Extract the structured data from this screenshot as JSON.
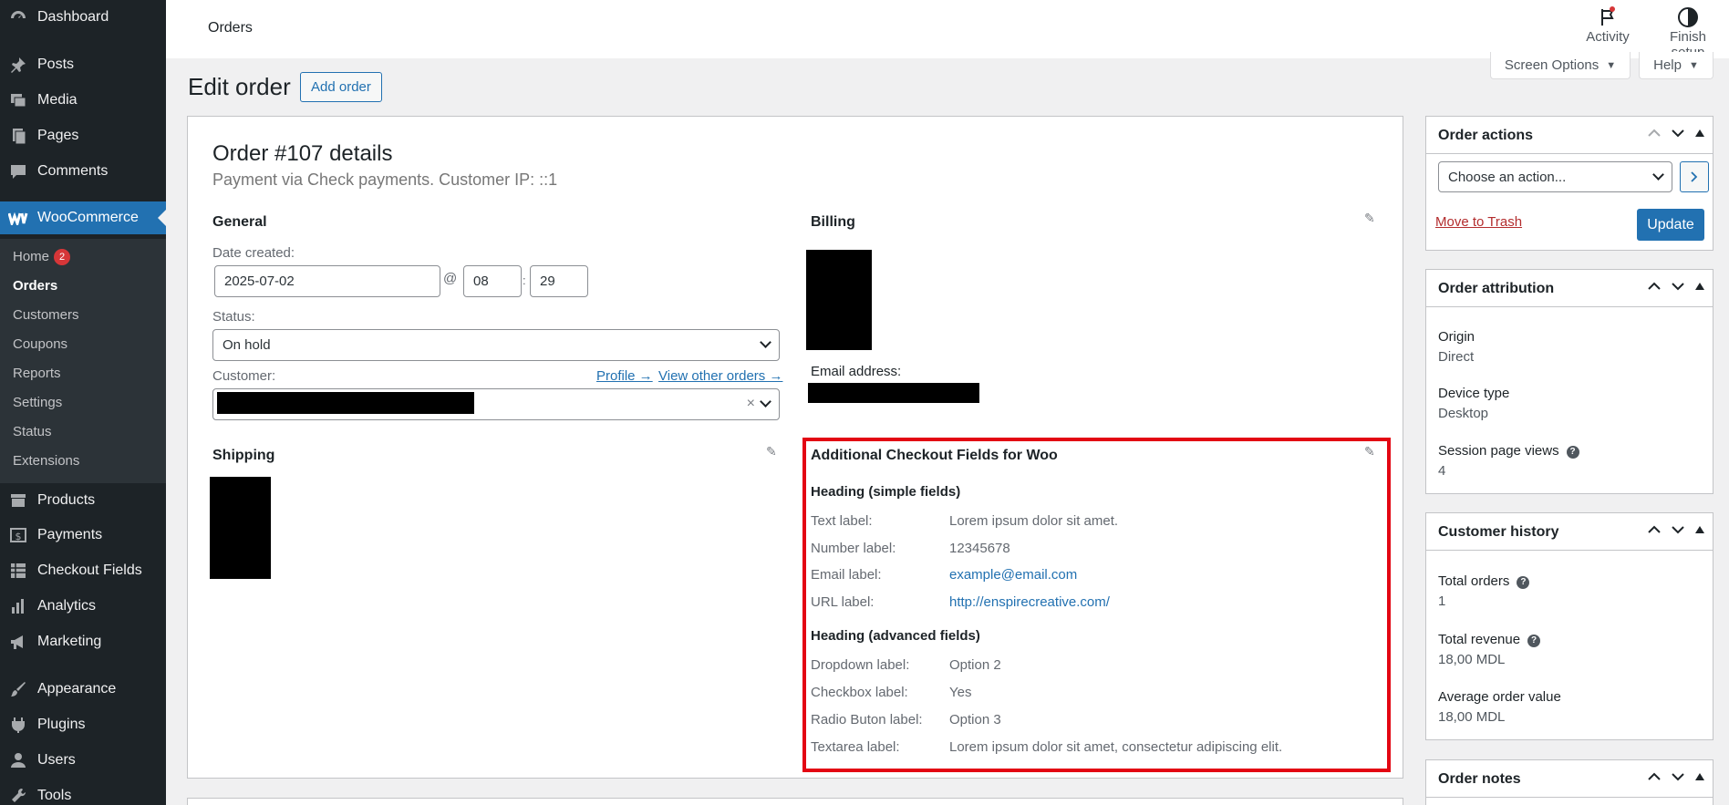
{
  "sidebar": {
    "items": [
      {
        "label": "Dashboard",
        "icon": "dashboard-icon"
      },
      {
        "label": "Posts",
        "icon": "pin-icon"
      },
      {
        "label": "Media",
        "icon": "media-icon"
      },
      {
        "label": "Pages",
        "icon": "pages-icon"
      },
      {
        "label": "Comments",
        "icon": "comments-icon"
      },
      {
        "label": "WooCommerce",
        "icon": "woocommerce-icon"
      },
      {
        "label": "Products",
        "icon": "products-icon"
      },
      {
        "label": "Payments",
        "icon": "payments-icon"
      },
      {
        "label": "Checkout Fields",
        "icon": "table-icon"
      },
      {
        "label": "Analytics",
        "icon": "analytics-icon"
      },
      {
        "label": "Marketing",
        "icon": "megaphone-icon"
      },
      {
        "label": "Appearance",
        "icon": "brush-icon"
      },
      {
        "label": "Plugins",
        "icon": "plug-icon"
      },
      {
        "label": "Users",
        "icon": "user-icon"
      },
      {
        "label": "Tools",
        "icon": "wrench-icon"
      }
    ],
    "submenu": [
      {
        "label": "Home",
        "badge": "2"
      },
      {
        "label": "Orders"
      },
      {
        "label": "Customers"
      },
      {
        "label": "Coupons"
      },
      {
        "label": "Reports"
      },
      {
        "label": "Settings"
      },
      {
        "label": "Status"
      },
      {
        "label": "Extensions"
      }
    ],
    "accent": "#2271b1"
  },
  "topbar": {
    "title": "Orders",
    "activity": "Activity",
    "finish_setup": "Finish setup"
  },
  "screen_options": {
    "label": "Screen Options",
    "help": "Help"
  },
  "heading": {
    "title": "Edit order",
    "add_order": "Add order"
  },
  "order": {
    "title": "Order #107 details",
    "subtitle": "Payment via Check payments. Customer IP: ::1",
    "general": {
      "heading": "General",
      "date_label": "Date created:",
      "date": "2025-07-02",
      "at": "@",
      "hour": "08",
      "colon": ":",
      "minute": "29",
      "status_label": "Status:",
      "status": "On hold",
      "customer_label": "Customer:",
      "profile_link": "Profile →",
      "other_orders_link": "View other orders →",
      "clear": "×"
    },
    "billing": {
      "heading": "Billing",
      "email_label": "Email address:"
    },
    "shipping": {
      "heading": "Shipping"
    },
    "additional": {
      "heading": "Additional Checkout Fields for Woo",
      "simple_heading": "Heading (simple fields)",
      "simple": [
        {
          "label": "Text label:",
          "value": "Lorem ipsum dolor sit amet."
        },
        {
          "label": "Number label:",
          "value": "12345678"
        },
        {
          "label": "Email label:",
          "value": "example@email.com"
        },
        {
          "label": "URL label:",
          "value": "http://enspirecreative.com/"
        }
      ],
      "advanced_heading": "Heading (advanced fields)",
      "advanced": [
        {
          "label": "Dropdown label:",
          "value": "Option 2"
        },
        {
          "label": "Checkbox label:",
          "value": "Yes"
        },
        {
          "label": "Radio Buton label:",
          "value": "Option 3"
        },
        {
          "label": "Textarea label:",
          "value": "Lorem ipsum dolor sit amet, consectetur adipiscing elit."
        }
      ],
      "highlight_color": "#e30613"
    }
  },
  "order_actions": {
    "title": "Order actions",
    "select": "Choose an action...",
    "trash": "Move to Trash",
    "update": "Update"
  },
  "order_attribution": {
    "title": "Order attribution",
    "origin_label": "Origin",
    "origin": "Direct",
    "device_label": "Device type",
    "device": "Desktop",
    "views_label": "Session page views",
    "views": "4"
  },
  "customer_history": {
    "title": "Customer history",
    "total_orders_label": "Total orders",
    "total_orders": "1",
    "total_revenue_label": "Total revenue",
    "total_revenue": "18,00 MDL",
    "aov_label": "Average order value",
    "aov": "18,00 MDL"
  },
  "order_notes": {
    "title": "Order notes"
  }
}
